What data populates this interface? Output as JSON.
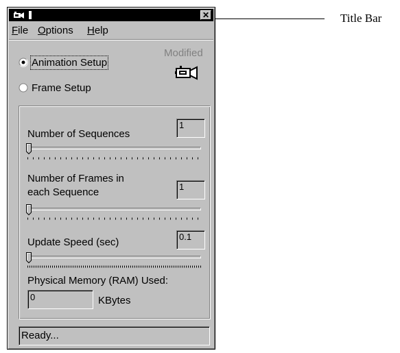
{
  "window": {
    "close_glyph": "✕"
  },
  "menu": [
    {
      "label": "File",
      "accel": "F",
      "rest": "ile"
    },
    {
      "label": "Options",
      "accel": "O",
      "rest": "ptions"
    },
    {
      "label": "Help",
      "accel": "H",
      "rest": "elp"
    }
  ],
  "mode": {
    "options": [
      {
        "label": "Animation Setup",
        "selected": true
      },
      {
        "label": "Frame Setup",
        "selected": false
      }
    ],
    "modified_label": "Modified",
    "camera_icon": "camera-icon"
  },
  "settings": {
    "sequences_label": "Number of Sequences",
    "sequences_value": "1",
    "frames_label_line1": "Number of Frames in",
    "frames_label_line2": "each Sequence",
    "frames_value": "1",
    "speed_label": "Update Speed (sec)",
    "speed_value": "0.1",
    "memory_label": "Physical Memory (RAM) Used:",
    "memory_value": "0",
    "memory_unit": "KBytes"
  },
  "status": {
    "text": "Ready..."
  },
  "callout": {
    "label": "Title Bar"
  }
}
